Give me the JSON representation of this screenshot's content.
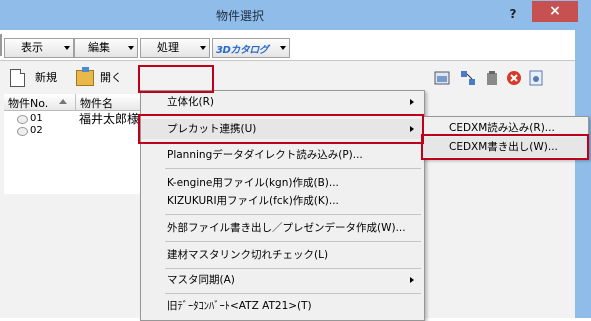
{
  "window": {
    "title": "物件選択",
    "help": "?",
    "close": "×"
  },
  "menubar": {
    "view": "表示",
    "edit": "編集",
    "process": "処理",
    "catalog": "3Dカタログ"
  },
  "toolbar": {
    "new": "新規",
    "open": "開く"
  },
  "table": {
    "col_no": "物件No.",
    "col_name": "物件名",
    "rows": [
      {
        "no": "01",
        "name": "福井太郎様"
      },
      {
        "no": "02",
        "name": ""
      }
    ]
  },
  "dropdown": {
    "items": [
      {
        "label": "立体化(R)"
      },
      {
        "label": "プレカット連携(U)"
      },
      {
        "label": "Planningデータダイレクト読み込み(P)..."
      },
      {
        "label": "K-engine用ファイル(kgn)作成(B)..."
      },
      {
        "label": "KIZUKURI用ファイル(fck)作成(K)..."
      },
      {
        "label": "外部ファイル書き出し／プレゼンデータ作成(W)..."
      },
      {
        "label": "建材マスタリンク切れチェック(L)"
      },
      {
        "label": "マスタ同期(A)"
      },
      {
        "label": "旧ﾃﾞｰﾀｺﾝﾊﾞｰﾄ<ATZ AT21>(T)"
      }
    ]
  },
  "submenu": {
    "items": [
      {
        "label": "CEDXM読み込み(R)..."
      },
      {
        "label": "CEDXM書き出し(W)..."
      }
    ]
  },
  "colors": {
    "title_bar": "#8fbce8",
    "close": "#c75050",
    "highlight": "#c00018"
  }
}
